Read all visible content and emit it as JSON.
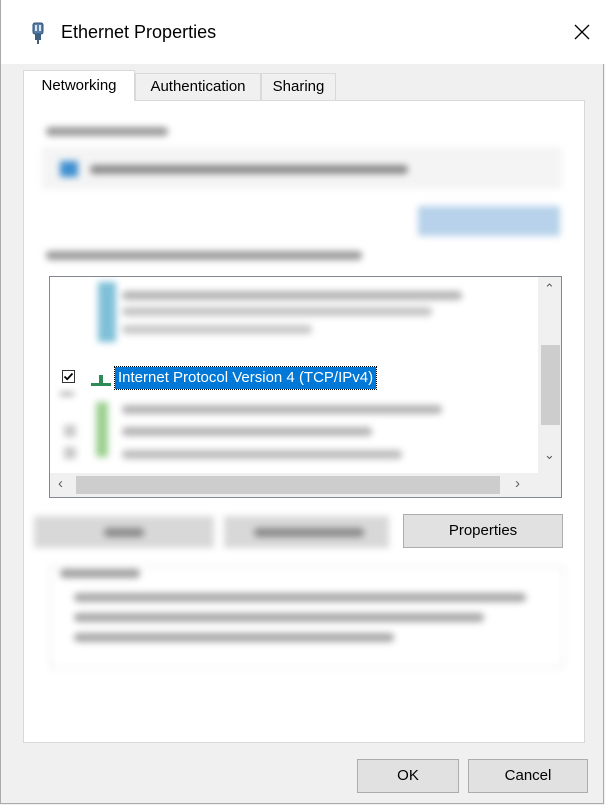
{
  "window": {
    "title": "Ethernet Properties"
  },
  "tabs": [
    {
      "label": "Networking",
      "active": true
    },
    {
      "label": "Authentication",
      "active": false
    },
    {
      "label": "Sharing",
      "active": false
    }
  ],
  "component_list": {
    "selected_item": {
      "label": "Internet Protocol Version 4 (TCP/IPv4)",
      "checked": true
    }
  },
  "buttons": {
    "properties": "Properties",
    "ok": "OK",
    "cancel": "Cancel"
  },
  "colors": {
    "selection": "#0078d7",
    "network_icon": "#2e8b57"
  }
}
